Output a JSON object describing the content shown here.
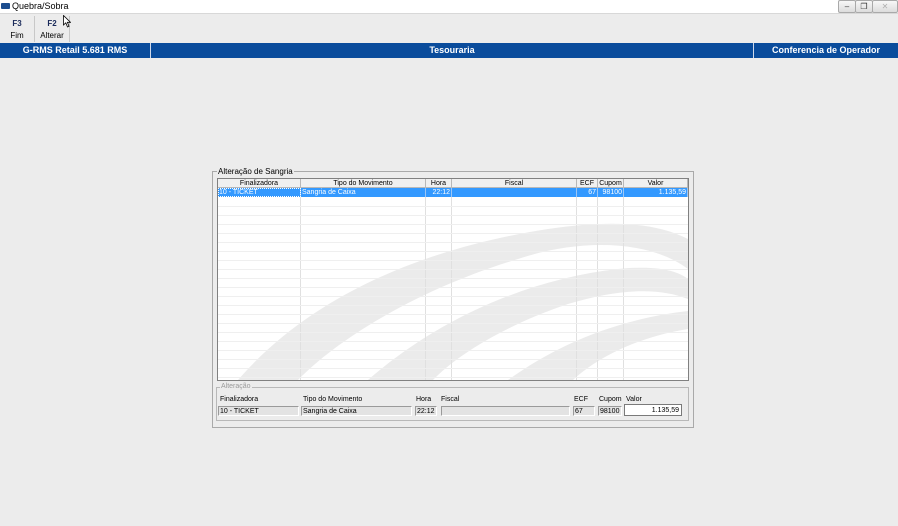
{
  "window": {
    "title": "Quebra/Sobra",
    "minimize_glyph": "‒",
    "restore_glyph": "❐",
    "close_glyph": "✕"
  },
  "toolbar": {
    "buttons": [
      {
        "key": "F3",
        "label": "Fim"
      },
      {
        "key": "F2",
        "label": "Alterar"
      }
    ]
  },
  "header": {
    "left": "G-RMS Retail 5.681 RMS",
    "center": "Tesouraria",
    "right": "Conferencia de Operador",
    "color": "#0a4c9c"
  },
  "sangria": {
    "legend": "Alteração de Sangria",
    "columns": [
      "Finalizadora",
      "Tipo do Movimento",
      "Hora",
      "Fiscal",
      "ECF",
      "Cupom",
      "Valor"
    ],
    "rows": [
      {
        "finalizadora": "10 - TICKET",
        "tipo": "Sangria de Caixa",
        "hora": "22:12",
        "fiscal": "",
        "ecf": "67",
        "cupom": "98100",
        "valor": "1.135,59"
      }
    ],
    "selection_color": "#3399ff"
  },
  "alteracao": {
    "legend": "Alteração",
    "labels": {
      "finalizadora": "Finalizadora",
      "tipo": "Tipo do Movimento",
      "hora": "Hora",
      "fiscal": "Fiscal",
      "ecf": "ECF",
      "cupom": "Cupom",
      "valor": "Valor"
    },
    "values": {
      "finalizadora": "10 - TICKET",
      "tipo": "Sangria de Caixa",
      "hora": "22:12",
      "fiscal": "",
      "ecf": "67",
      "cupom": "98100",
      "valor": "1.135,59"
    }
  }
}
